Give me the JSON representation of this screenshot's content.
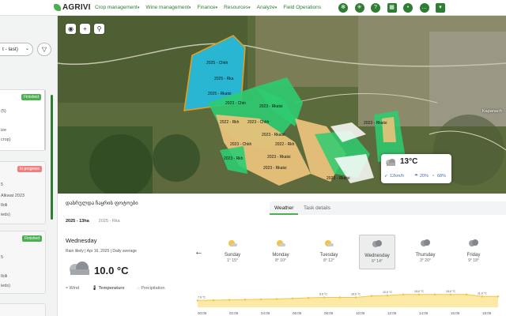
{
  "topbar": {
    "logo": "AGRIVI",
    "nav": [
      {
        "label": "Crop management"
      },
      {
        "label": "Wine management"
      },
      {
        "label": "Finance"
      },
      {
        "label": "Resources"
      },
      {
        "label": "Analyze"
      },
      {
        "label": "Field Operations"
      }
    ],
    "icons": [
      "gear-icon",
      "network-icon",
      "help-icon",
      "calendar-icon",
      "bell-icon",
      "chat-icon",
      "farm-icon"
    ]
  },
  "sidebar": {
    "sort_value": "t - last)",
    "cards": [
      {
        "status": "Finished",
        "lines": [
          "(5)",
          "ize",
          "crop)"
        ]
      },
      {
        "status": "In progress",
        "lines": [
          "5",
          "Alkwat 2023",
          "Ibili",
          "ieds)"
        ]
      },
      {
        "status": "Finished",
        "lines": [
          "5",
          "Ibili",
          "ieds)"
        ]
      }
    ]
  },
  "map": {
    "field_labels": [
      "2025 - Chkh",
      "2025 - Rka",
      "2025 - Rkatsi",
      "2023 - Chin",
      "2023 - Rkatsi",
      "2022 - Rkh",
      "2023 - Chkh",
      "2023 - Rkatsi",
      "2023 - Chkh",
      "2022 - Rkh",
      "2023 - Rkatsi",
      "2023 - Rkatsi",
      "2023 - Rkatsi",
      "2023 - Rkatsi",
      "2023 - Rkh"
    ],
    "town_label": "Kapanach",
    "weather": {
      "temp": "13°C",
      "wind": "12km/h",
      "precip": "20%",
      "humidity": "68%"
    }
  },
  "panel": {
    "title": "დასრულდა ჩაყრის ფოტოები",
    "tabs": [
      {
        "label": "Weather"
      },
      {
        "label": "Task details"
      }
    ],
    "subtabs": [
      "2025 - 13ha",
      "2025 - Rka"
    ],
    "current": {
      "day": "Wednesday",
      "meta": [
        "Rain likely",
        "Apr 16, 2025",
        "Daily average"
      ],
      "temp": "10.0 °C",
      "legend": [
        "Wind",
        "Temperature",
        "Precipitation"
      ]
    },
    "days": [
      {
        "name": "Sunday",
        "range": "1° 15°"
      },
      {
        "name": "Monday",
        "range": "8° 10°"
      },
      {
        "name": "Tuesday",
        "range": "8° 12°"
      },
      {
        "name": "Wednesday",
        "range": "6° 14°"
      },
      {
        "name": "Thursday",
        "range": "3° 20°"
      },
      {
        "name": "Friday",
        "range": "9° 18°"
      }
    ]
  },
  "chart_data": {
    "type": "area",
    "x": [
      "00:00",
      "01:00",
      "02:00",
      "03:00",
      "04:00",
      "05:00",
      "06:00",
      "07:00",
      "08:00",
      "09:00",
      "10:00",
      "11:00",
      "12:00",
      "13:00",
      "14:00",
      "15:00",
      "16:00",
      "17:00",
      "18:00",
      "19:00"
    ],
    "series": [
      {
        "values": [
          7.0,
          7.2,
          7.5,
          7.8,
          8.1,
          8.4,
          9.0,
          9.6,
          10.0,
          10.0,
          10.0,
          11.5,
          12.0,
          13.0,
          13.0,
          13.0,
          13.0,
          13.0,
          11.0,
          11.0
        ]
      }
    ],
    "value_labels": [
      {
        "x": "00:00",
        "text": "7.0 °C"
      },
      {
        "x": "08:00",
        "text": "9.0 °C"
      },
      {
        "x": "10:00",
        "text": "10.0 °C"
      },
      {
        "x": "12:00",
        "text": "12.0 °C"
      },
      {
        "x": "14:00",
        "text": "13.0 °C"
      },
      {
        "x": "16:00",
        "text": "13.0 °C"
      },
      {
        "x": "18:00",
        "text": "11.0 °C"
      }
    ],
    "tick_labels": [
      "00:00",
      "02:00",
      "04:00",
      "06:00",
      "08:00",
      "10:00",
      "12:00",
      "14:00",
      "16:00",
      "18:00"
    ],
    "ylim": [
      0,
      16
    ],
    "colors": {
      "fill": "#fde9a6",
      "line": "#f4c542",
      "marker": "#f4c542"
    }
  },
  "colors": {
    "brand": "#2e7d32",
    "accent": "#4caf50",
    "selected_field": "#29b6d3",
    "field_green": "#2ecc71",
    "field_tan": "#e8c27a"
  }
}
